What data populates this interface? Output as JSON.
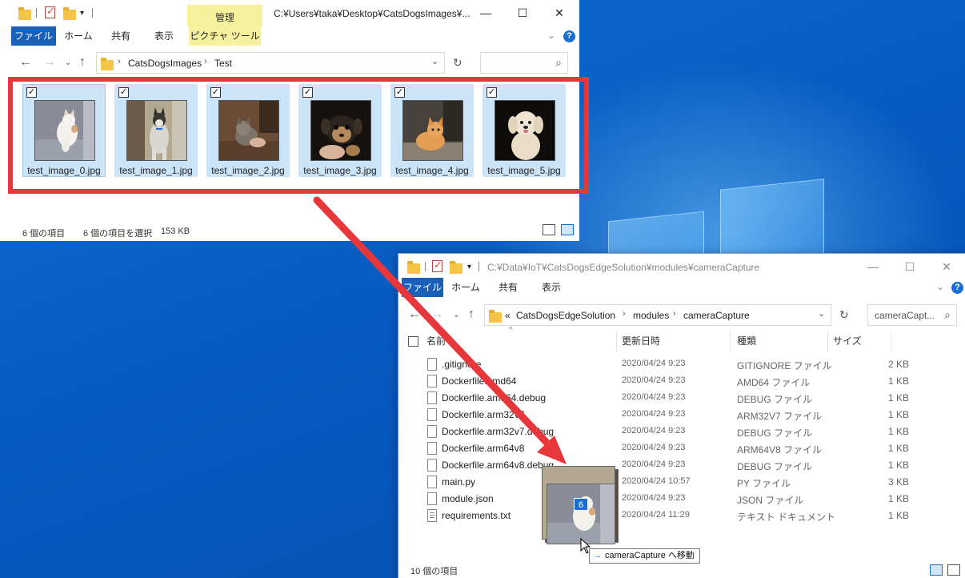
{
  "colors": {
    "accent": "#1960b8",
    "highlight_red": "#e8373a",
    "selection": "#cce4f8",
    "manage_tab": "#f6f19c",
    "desktop": "#0a63c9"
  },
  "window1": {
    "title_path": "C:¥Users¥taka¥Desktop¥CatsDogsImages¥...",
    "ribbon_tabs": {
      "file": "ファイル",
      "home": "ホーム",
      "share": "共有",
      "view": "表示",
      "picture_tools": "ピクチャ ツール",
      "manage": "管理"
    },
    "breadcrumb": [
      "CatsDogsImages",
      "Test"
    ],
    "search_placeholder": "",
    "files": [
      {
        "name": "test_image_0.jpg",
        "checked": true,
        "subject": "cat-white"
      },
      {
        "name": "test_image_1.jpg",
        "checked": true,
        "subject": "dog-husky"
      },
      {
        "name": "test_image_2.jpg",
        "checked": true,
        "subject": "cat-held"
      },
      {
        "name": "test_image_3.jpg",
        "checked": true,
        "subject": "dog-puppy"
      },
      {
        "name": "test_image_4.jpg",
        "checked": true,
        "subject": "cat-orange"
      },
      {
        "name": "test_image_5.jpg",
        "checked": true,
        "subject": "dog-poodle"
      }
    ],
    "status": {
      "item_count": "6 個の項目",
      "selection": "6 個の項目を選択",
      "size": "153 KB"
    }
  },
  "window2": {
    "title_path": "C:¥Data¥IoT¥CatsDogsEdgeSolution¥modules¥cameraCapture",
    "ribbon_tabs": {
      "file": "ファイル",
      "home": "ホーム",
      "share": "共有",
      "view": "表示"
    },
    "breadcrumb_prefix": "«",
    "breadcrumb": [
      "CatsDogsEdgeSolution",
      "modules",
      "cameraCapture"
    ],
    "search_placeholder": "cameraCapt...",
    "columns": {
      "name": "名前",
      "date": "更新日時",
      "type": "種類",
      "size": "サイズ"
    },
    "rows": [
      {
        "name": ".gitignore",
        "date": "2020/04/24 9:23",
        "type": "GITIGNORE ファイル",
        "size": "2 KB",
        "icon": "file-icon"
      },
      {
        "name": "Dockerfile.amd64",
        "date": "2020/04/24 9:23",
        "type": "AMD64 ファイル",
        "size": "1 KB",
        "icon": "file-icon"
      },
      {
        "name": "Dockerfile.amd64.debug",
        "date": "2020/04/24 9:23",
        "type": "DEBUG ファイル",
        "size": "1 KB",
        "icon": "file-icon"
      },
      {
        "name": "Dockerfile.arm32v7",
        "date": "2020/04/24 9:23",
        "type": "ARM32V7 ファイル",
        "size": "1 KB",
        "icon": "file-icon"
      },
      {
        "name": "Dockerfile.arm32v7.debug",
        "date": "2020/04/24 9:23",
        "type": "DEBUG ファイル",
        "size": "1 KB",
        "icon": "file-icon"
      },
      {
        "name": "Dockerfile.arm64v8",
        "date": "2020/04/24 9:23",
        "type": "ARM64V8 ファイル",
        "size": "1 KB",
        "icon": "file-icon"
      },
      {
        "name": "Dockerfile.arm64v8.debug",
        "date": "2020/04/24 9:23",
        "type": "DEBUG ファイル",
        "size": "1 KB",
        "icon": "file-icon"
      },
      {
        "name": "main.py",
        "date": "2020/04/24 10:57",
        "type": "PY ファイル",
        "size": "3 KB",
        "icon": "file-icon"
      },
      {
        "name": "module.json",
        "date": "2020/04/24 9:23",
        "type": "JSON ファイル",
        "size": "1 KB",
        "icon": "file-icon"
      },
      {
        "name": "requirements.txt",
        "date": "2020/04/24 11:29",
        "type": "テキスト ドキュメント",
        "size": "1 KB",
        "icon": "text-file-icon"
      }
    ],
    "status": {
      "item_count": "10 個の項目"
    }
  },
  "drag": {
    "count": "6",
    "tooltip": "cameraCapture へ移動"
  }
}
